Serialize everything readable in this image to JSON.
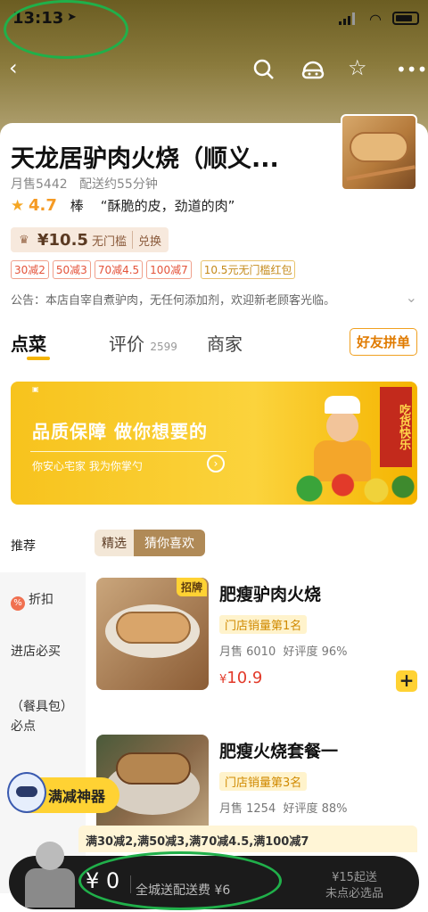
{
  "status_bar": {
    "time": "13:13",
    "location_icon": "location-arrow-icon",
    "signal_icon": "signal-icon",
    "wifi_icon": "wifi-icon",
    "battery_icon": "battery-icon"
  },
  "nav": {
    "back_icon": "back-icon",
    "search_icon": "search-icon",
    "service_icon": "customer-service-icon",
    "favorite_icon": "star-outline-icon",
    "more_icon": "more-icon"
  },
  "store": {
    "name": "天龙居驴肉火烧（顺义...",
    "monthly_sales": "月售5442",
    "delivery_time": "配送约55分钟",
    "rating": "4.7",
    "rating_word": "棒",
    "review_quote": "“酥脆的皮，劲道的肉”",
    "coupon": {
      "amount": "¥10.5",
      "condition": "无门槛",
      "action": "兑换"
    },
    "promos": [
      "30减2",
      "50减3",
      "70减4.5",
      "100减7"
    ],
    "red_packet": "10.5元无门槛红包",
    "notice": "公告：本店自宰自煮驴肉，无任何添加剂，欢迎新老顾客光临。"
  },
  "tabs": [
    {
      "label": "点菜",
      "count": ""
    },
    {
      "label": "评价",
      "count": "2599"
    },
    {
      "label": "商家",
      "count": ""
    }
  ],
  "group_order_label": "好友拼单",
  "banner": {
    "title": "品质保障 做你想要的",
    "subtitle": "你安心宅家  我为你掌勺",
    "slogan": "吃货快乐"
  },
  "sidebar": {
    "top_label": "推荐",
    "items": [
      {
        "label": "折扣",
        "icon": "discount-icon"
      },
      {
        "label": "进店必买"
      },
      {
        "label": "（餐具包）必点"
      }
    ]
  },
  "filters": [
    "精选",
    "猜你喜欢"
  ],
  "dishes": [
    {
      "tag": "招牌",
      "name": "肥瘦驴肉火烧",
      "rank": "门店销量第1名",
      "sales": "月售 6010",
      "rating": "好评度 96%",
      "price_symbol": "¥",
      "price": "10.9"
    },
    {
      "tag": "",
      "name": "肥瘦火烧套餐一",
      "rank": "门店销量第3名",
      "sales": "月售 1254",
      "rating": "好评度 88%",
      "price_symbol": "",
      "price": ""
    }
  ],
  "helper_label": "满减神器",
  "discount_strip": "满30减2,满50减3,满70减4.5,满100减7",
  "cart": {
    "amount": "¥ 0",
    "delivery_fee": "全城送配送费 ¥6",
    "minimum": "¥15起送",
    "required": "未点必选品"
  },
  "colors": {
    "accent": "#ffd233",
    "price_red": "#e23a2a",
    "annotation": "#20b04a"
  }
}
